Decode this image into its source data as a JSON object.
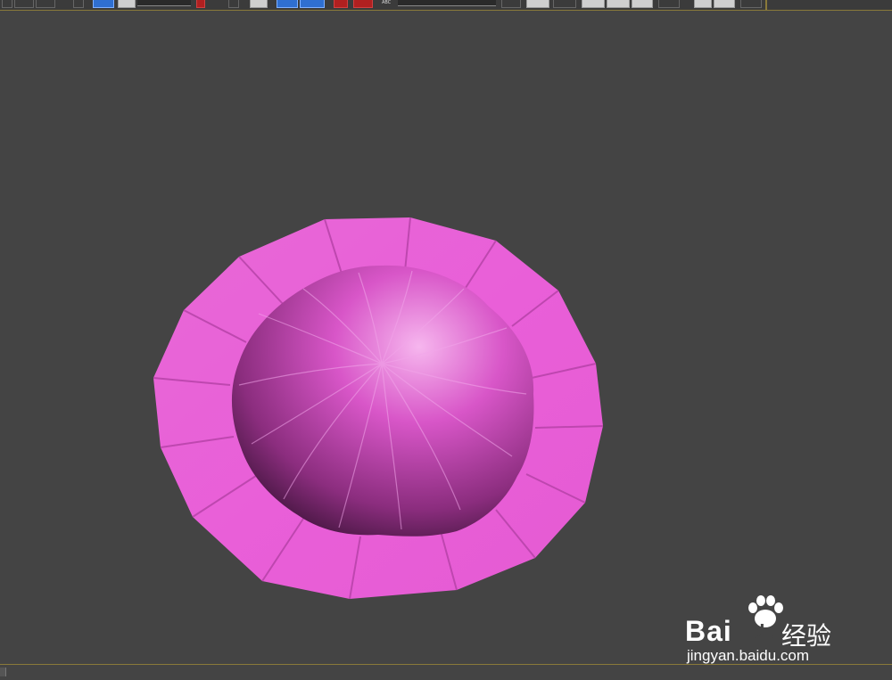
{
  "toolbar": {
    "abc_label": "ABC"
  },
  "watermark": {
    "brand_left": "Bai",
    "brand_right": "du",
    "brand_cn": "经验",
    "url": "jingyan.baidu.com"
  },
  "colors": {
    "viewport_bg": "#444444",
    "model_pink": "#e35ad2",
    "dome_magenta": "#c949b8",
    "active_button": "#2f6fd1",
    "border_accent": "#8a7a3a"
  },
  "icons": {
    "move": "move-arrow-icon",
    "rotate": "rotate-circle-icon",
    "snap": "snap-magnet-icon",
    "render": "render-teapot-icon"
  }
}
